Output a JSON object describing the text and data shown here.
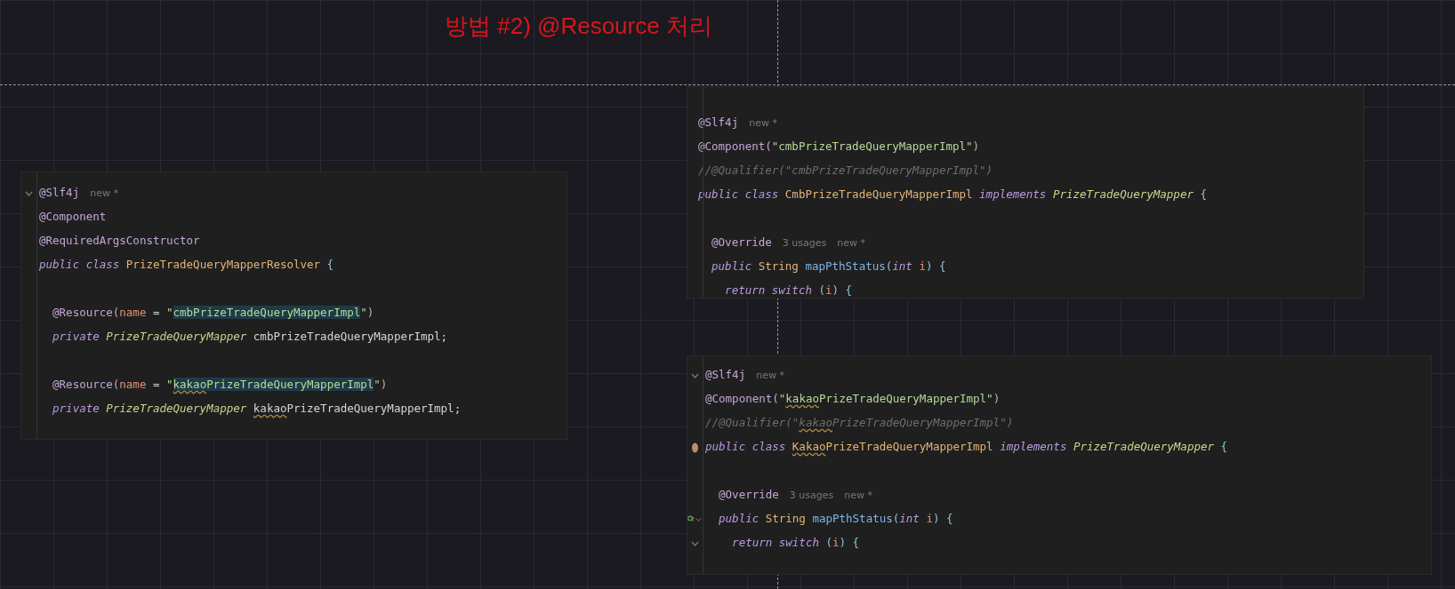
{
  "title": "방법 #2) @Resource 처리",
  "panels": [
    {
      "lines": [
        {
          "kind": "code",
          "fold": true,
          "tokens": [
            {
              "text": "@Slf4j",
              "kind": "annotation"
            },
            {
              "text": "new *",
              "kind": "hint"
            }
          ]
        },
        {
          "kind": "code",
          "tokens": [
            {
              "text": "@Component",
              "kind": "annotation"
            }
          ]
        },
        {
          "kind": "code",
          "tokens": [
            {
              "text": "@RequiredArgsConstructor",
              "kind": "annotation"
            }
          ]
        },
        {
          "kind": "code",
          "tokens": [
            {
              "text": "public class ",
              "kind": "keyword"
            },
            {
              "text": "PrizeTradeQueryMapperResolver",
              "kind": "class"
            },
            {
              "text": " {",
              "kind": "punct"
            }
          ]
        },
        {
          "kind": "blank"
        },
        {
          "kind": "code",
          "tokens": [
            {
              "text": "  @Resource(",
              "kind": "annotation"
            },
            {
              "text": "name",
              "kind": "param"
            },
            {
              "text": " = ",
              "kind": "plain"
            },
            {
              "text": "\"",
              "kind": "string"
            },
            {
              "text": "cmbPrizeTradeQueryMapperImpl",
              "kind": "string",
              "highlight": true
            },
            {
              "text": "\"",
              "kind": "string"
            },
            {
              "text": ")",
              "kind": "annotation"
            }
          ]
        },
        {
          "kind": "code",
          "tokens": [
            {
              "text": "  private ",
              "kind": "keyword"
            },
            {
              "text": "PrizeTradeQueryMapper ",
              "kind": "type"
            },
            {
              "text": "cmbPrizeTradeQueryMapperImpl;",
              "kind": "plain"
            }
          ]
        },
        {
          "kind": "blank"
        },
        {
          "kind": "code",
          "tokens": [
            {
              "text": "  @Resource(",
              "kind": "annotation"
            },
            {
              "text": "name",
              "kind": "param"
            },
            {
              "text": " = ",
              "kind": "plain"
            },
            {
              "text": "\"",
              "kind": "string"
            },
            {
              "text": "kakao",
              "kind": "string",
              "highlight": true,
              "typo": true
            },
            {
              "text": "PrizeTradeQueryMapperImpl",
              "kind": "string",
              "highlight": true
            },
            {
              "text": "\"",
              "kind": "string"
            },
            {
              "text": ")",
              "kind": "annotation"
            }
          ]
        },
        {
          "kind": "code",
          "tokens": [
            {
              "text": "  private ",
              "kind": "keyword"
            },
            {
              "text": "PrizeTradeQueryMapper ",
              "kind": "type"
            },
            {
              "text": "kakao",
              "kind": "plain",
              "typo": true
            },
            {
              "text": "PrizeTradeQueryMapperImpl;",
              "kind": "plain"
            }
          ]
        }
      ]
    },
    {
      "lines": [
        {
          "kind": "blank"
        },
        {
          "kind": "code",
          "tokens": [
            {
              "text": "@Slf4j",
              "kind": "annotation"
            },
            {
              "text": "new *",
              "kind": "hint"
            }
          ]
        },
        {
          "kind": "code",
          "tokens": [
            {
              "text": "@Component(",
              "kind": "annotation"
            },
            {
              "text": "\"cmbPrizeTradeQueryMapperImpl\"",
              "kind": "string"
            },
            {
              "text": ")",
              "kind": "annotation"
            }
          ]
        },
        {
          "kind": "code",
          "tokens": [
            {
              "text": "//@Qualifier(\"cmbPrizeTradeQueryMapperImpl\")",
              "kind": "comment"
            }
          ]
        },
        {
          "kind": "code",
          "tokens": [
            {
              "text": "public class ",
              "kind": "keyword"
            },
            {
              "text": "CmbPrizeTradeQueryMapperImpl ",
              "kind": "class"
            },
            {
              "text": "implements ",
              "kind": "keyword"
            },
            {
              "text": "PrizeTradeQueryMapper",
              "kind": "type"
            },
            {
              "text": " {",
              "kind": "punct"
            }
          ]
        },
        {
          "kind": "blank"
        },
        {
          "kind": "code",
          "tokens": [
            {
              "text": "  @Override",
              "kind": "annotation"
            },
            {
              "text": "3 usages",
              "kind": "hint"
            },
            {
              "text": "new *",
              "kind": "hint"
            }
          ]
        },
        {
          "kind": "code",
          "tokens": [
            {
              "text": "  public ",
              "kind": "keyword"
            },
            {
              "text": "String ",
              "kind": "class"
            },
            {
              "text": "mapPthStatus",
              "kind": "method"
            },
            {
              "text": "(",
              "kind": "punct"
            },
            {
              "text": "int ",
              "kind": "keyword"
            },
            {
              "text": "i",
              "kind": "param"
            },
            {
              "text": ") {",
              "kind": "punct"
            }
          ]
        },
        {
          "kind": "code",
          "tokens": [
            {
              "text": "    return switch ",
              "kind": "keyword"
            },
            {
              "text": "(",
              "kind": "punct"
            },
            {
              "text": "i",
              "kind": "param"
            },
            {
              "text": ") {",
              "kind": "punct"
            }
          ]
        }
      ]
    },
    {
      "lines": [
        {
          "kind": "code",
          "fold": true,
          "tokens": [
            {
              "text": "@Slf4j",
              "kind": "annotation"
            },
            {
              "text": "new *",
              "kind": "hint"
            }
          ]
        },
        {
          "kind": "code",
          "tokens": [
            {
              "text": "@Component(",
              "kind": "annotation"
            },
            {
              "text": "\"",
              "kind": "string"
            },
            {
              "text": "kakao",
              "kind": "string",
              "typo": true
            },
            {
              "text": "PrizeTradeQueryMapperImpl\"",
              "kind": "string"
            },
            {
              "text": ")",
              "kind": "annotation"
            }
          ]
        },
        {
          "kind": "code",
          "tokens": [
            {
              "text": "//@Qualifier(\"",
              "kind": "comment"
            },
            {
              "text": "kakao",
              "kind": "comment",
              "typo": true
            },
            {
              "text": "PrizeTradeQueryMapperImpl\")",
              "kind": "comment"
            }
          ]
        },
        {
          "kind": "code",
          "bean_marker": true,
          "tokens": [
            {
              "text": "public class ",
              "kind": "keyword"
            },
            {
              "text": "Kakao",
              "kind": "class",
              "typo": true
            },
            {
              "text": "PrizeTradeQueryMapperImpl ",
              "kind": "class"
            },
            {
              "text": "implements ",
              "kind": "keyword"
            },
            {
              "text": "PrizeTradeQueryMapper",
              "kind": "type"
            },
            {
              "text": " {",
              "kind": "punct"
            }
          ]
        },
        {
          "kind": "blank"
        },
        {
          "kind": "code",
          "tokens": [
            {
              "text": "  @Override",
              "kind": "annotation"
            },
            {
              "text": "3 usages",
              "kind": "hint"
            },
            {
              "text": "new *",
              "kind": "hint"
            }
          ]
        },
        {
          "kind": "code",
          "fold": true,
          "override_marker": true,
          "tokens": [
            {
              "text": "  public ",
              "kind": "keyword"
            },
            {
              "text": "String ",
              "kind": "class"
            },
            {
              "text": "mapPthStatus",
              "kind": "method"
            },
            {
              "text": "(",
              "kind": "punct"
            },
            {
              "text": "int ",
              "kind": "keyword"
            },
            {
              "text": "i",
              "kind": "param"
            },
            {
              "text": ") {",
              "kind": "punct"
            }
          ]
        },
        {
          "kind": "code",
          "fold": true,
          "tokens": [
            {
              "text": "    return switch ",
              "kind": "keyword"
            },
            {
              "text": "(",
              "kind": "punct"
            },
            {
              "text": "i",
              "kind": "param"
            },
            {
              "text": ") {",
              "kind": "punct"
            }
          ]
        }
      ]
    }
  ]
}
